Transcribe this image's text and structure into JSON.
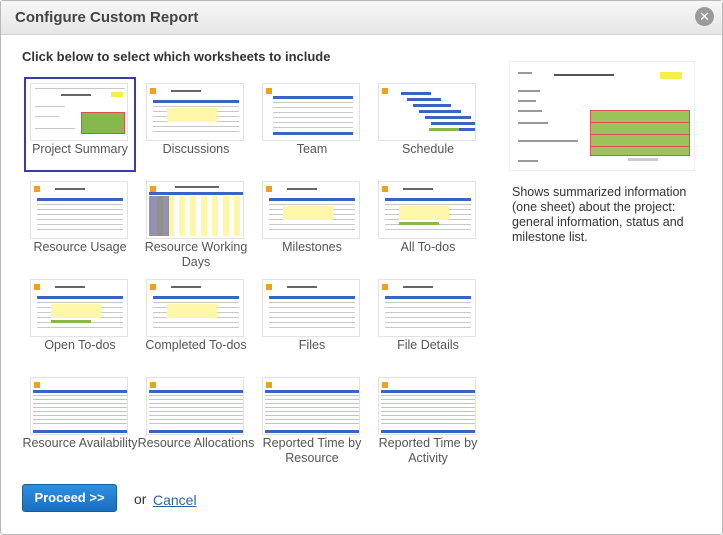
{
  "dialog": {
    "title": "Configure Custom Report",
    "instruction": "Click below to select which worksheets to include"
  },
  "worksheets": [
    {
      "label": "Project Summary",
      "selected": true
    },
    {
      "label": "Discussions"
    },
    {
      "label": "Team"
    },
    {
      "label": "Schedule"
    },
    {
      "label": "Resource Usage"
    },
    {
      "label": "Resource Working Days"
    },
    {
      "label": "Milestones"
    },
    {
      "label": "All To-dos"
    },
    {
      "label": "Open To-dos"
    },
    {
      "label": "Completed To-dos"
    },
    {
      "label": "Files"
    },
    {
      "label": "File Details"
    },
    {
      "label": "Resource Availability"
    },
    {
      "label": "Resource Allocations"
    },
    {
      "label": "Reported Time by Resource"
    },
    {
      "label": "Reported Time by Activity"
    }
  ],
  "description": "Shows summarized information (one sheet) about the project: general information, status and milestone list.",
  "actions": {
    "proceed_label": "Proceed >>",
    "or_text": "or",
    "cancel_label": "Cancel"
  },
  "colors": {
    "accent": "#1a6fc0",
    "selection": "#3b3ba8",
    "link": "#2a62a8"
  }
}
